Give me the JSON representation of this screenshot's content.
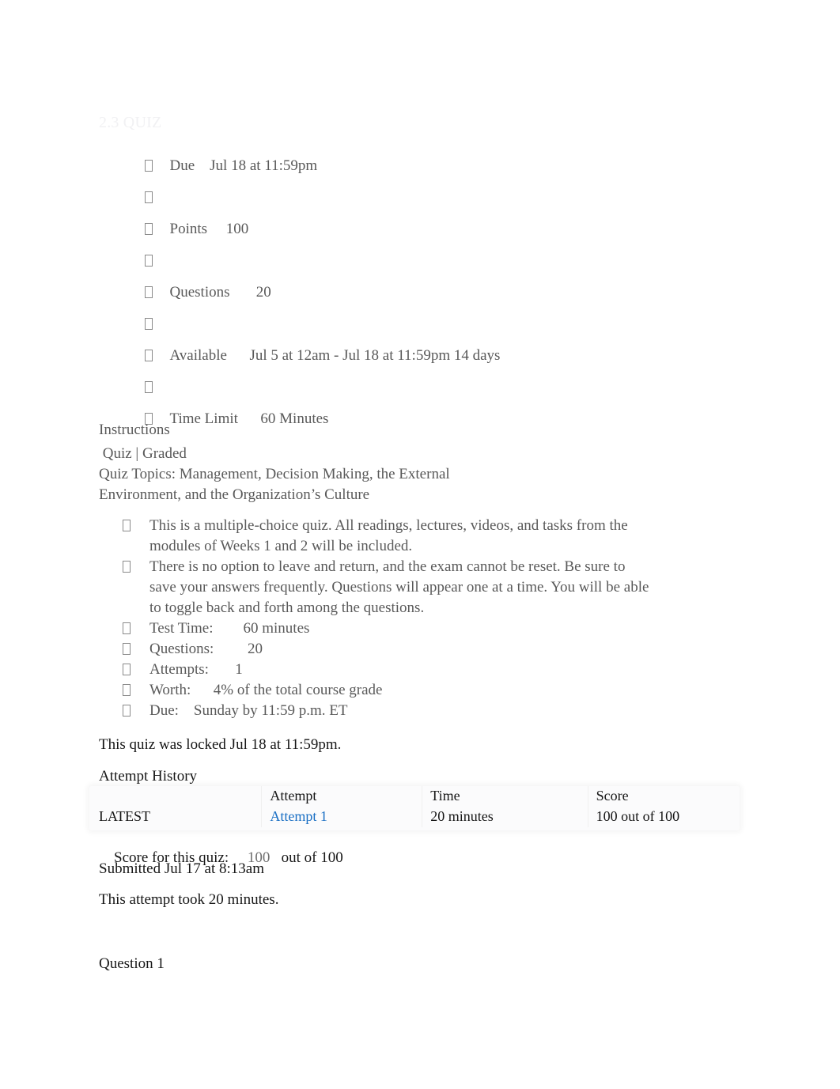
{
  "document": {
    "title": "2.3 QUIZ"
  },
  "meta": {
    "rows": [
      {
        "label": "Due",
        "value": "Jul 18 at 11:59pm",
        "bullet": "tofu-box-glyph",
        "spacer": false
      },
      {
        "label": "",
        "value": "",
        "bullet": "tofu-box-glyph",
        "spacer": true
      },
      {
        "label": "Points",
        "value": "100",
        "bullet": "tofu-box-glyph",
        "spacer": false
      },
      {
        "label": "",
        "value": "",
        "bullet": "tofu-box-glyph",
        "spacer": true
      },
      {
        "label": "Questions",
        "value": "20",
        "bullet": "tofu-box-glyph",
        "spacer": false
      },
      {
        "label": "",
        "value": "",
        "bullet": "tofu-box-glyph",
        "spacer": true
      },
      {
        "label": "Available",
        "value": "Jul 5 at 12am - Jul 18 at 11:59pm 14 days",
        "bullet": "tofu-box-glyph",
        "spacer": false
      },
      {
        "label": "",
        "value": "",
        "bullet": "tofu-box-glyph",
        "spacer": true
      },
      {
        "label": "Time Limit",
        "value": "60 Minutes",
        "bullet": "tofu-box-glyph",
        "spacer": false
      }
    ],
    "row_text": [
      "Due    Jul 18 at 11:59pm",
      "",
      "Points     100",
      "",
      "Questions       20",
      "",
      "Available      Jul 5 at 12am - Jul 18 at 11:59pm 14 days",
      "",
      "Time Limit      60 Minutes"
    ]
  },
  "instructions": {
    "heading": "Instructions",
    "intro_lines": [
      " Quiz | Graded",
      "Quiz Topics: Management, Decision Making, the External",
      "Environment, and the Organization’s Culture"
    ],
    "items": [
      "This is a multiple-choice quiz. All readings, lectures, videos, and tasks from the modules of Weeks 1 and 2 will be included.",
      "There is no option to leave and return, and the exam cannot be reset. Be sure to save your answers frequently. Questions will appear one at a time. You will be able to toggle back and forth among the questions.",
      "Test Time:        60 minutes",
      "Questions:         20",
      "Attempts:       1",
      "Worth:      4% of the total course grade",
      "Due:    Sunday by 11:59 p.m. ET"
    ]
  },
  "status": {
    "locked_note": "This quiz was locked Jul 18 at 11:59pm.",
    "attempt_history_heading": "Attempt History"
  },
  "attempt_history": {
    "columns": [
      "",
      "Attempt",
      "Time",
      "Score"
    ],
    "rows": [
      {
        "label": "LATEST",
        "attempt": "Attempt 1",
        "time": "20 minutes",
        "score": "100 out of 100"
      }
    ],
    "link_color": "#1a6fc4"
  },
  "score_summary": {
    "label": "Score for this quiz:",
    "value": "100",
    "out_of": "out of 100",
    "submitted": "Submitted Jul 17 at 8:13am",
    "duration": "This attempt took 20 minutes."
  },
  "question": {
    "heading": "Question 1"
  },
  "colors": {
    "title": "#f1f1f3",
    "muted_text": "#595959",
    "body_text": "#161616",
    "link": "#1a6fc4",
    "table_bg": "#fbfbfc",
    "page_bg": "#ffffff"
  }
}
